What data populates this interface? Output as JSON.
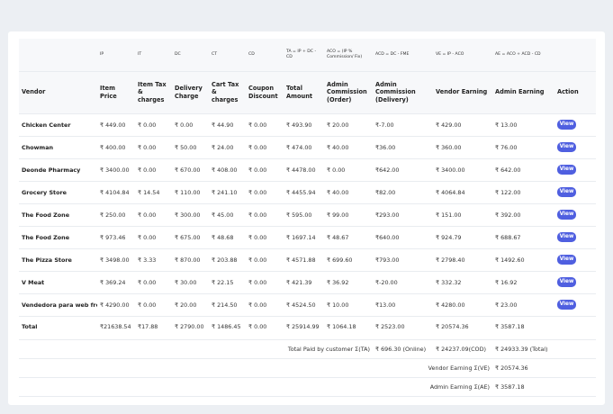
{
  "header": {
    "formulas": [
      "",
      "IP",
      "IT",
      "DC",
      "CT",
      "CD",
      "TA = IP + DC - CD",
      "ACO = (IP % Commission/ Fix)",
      "ACD = DC - FME",
      "VE = IP - ACO",
      "AE = ACO + ACD - CD",
      ""
    ],
    "labels": [
      "Vendor",
      "Item Price",
      "Item Tax & charges",
      "Delivery Charge",
      "Cart Tax & charges",
      "Coupon Discount",
      "Total Amount",
      "Admin Commission (Order)",
      "Admin Commission (Delivery)",
      "Vendor Earning",
      "Admin Earning",
      "Action"
    ]
  },
  "view_label": "View",
  "rows": [
    {
      "vendor": "Chicken Center",
      "ip": "₹ 449.00",
      "it": "₹ 0.00",
      "dc": "₹ 0.00",
      "ct": "₹ 44.90",
      "cd": "₹ 0.00",
      "ta": "₹ 493.90",
      "aco": "₹ 20.00",
      "acd": "₹-7.00",
      "ve": "₹ 429.00",
      "ae": "₹ 13.00"
    },
    {
      "vendor": "Chowman",
      "ip": "₹ 400.00",
      "it": "₹ 0.00",
      "dc": "₹ 50.00",
      "ct": "₹ 24.00",
      "cd": "₹ 0.00",
      "ta": "₹ 474.00",
      "aco": "₹ 40.00",
      "acd": "₹36.00",
      "ve": "₹ 360.00",
      "ae": "₹ 76.00"
    },
    {
      "vendor": "Deonde Pharmacy",
      "ip": "₹ 3400.00",
      "it": "₹ 0.00",
      "dc": "₹ 670.00",
      "ct": "₹ 408.00",
      "cd": "₹ 0.00",
      "ta": "₹ 4478.00",
      "aco": "₹ 0.00",
      "acd": "₹642.00",
      "ve": "₹ 3400.00",
      "ae": "₹ 642.00"
    },
    {
      "vendor": "Grocery Store",
      "ip": "₹ 4104.84",
      "it": "₹ 14.54",
      "dc": "₹ 110.00",
      "ct": "₹ 241.10",
      "cd": "₹ 0.00",
      "ta": "₹ 4455.94",
      "aco": "₹ 40.00",
      "acd": "₹82.00",
      "ve": "₹ 4064.84",
      "ae": "₹ 122.00"
    },
    {
      "vendor": "The Food Zone",
      "ip": "₹ 250.00",
      "it": "₹ 0.00",
      "dc": "₹ 300.00",
      "ct": "₹ 45.00",
      "cd": "₹ 0.00",
      "ta": "₹ 595.00",
      "aco": "₹ 99.00",
      "acd": "₹293.00",
      "ve": "₹ 151.00",
      "ae": "₹ 392.00"
    },
    {
      "vendor": "The Food Zone",
      "ip": "₹ 973.46",
      "it": "₹ 0.00",
      "dc": "₹ 675.00",
      "ct": "₹ 48.68",
      "cd": "₹ 0.00",
      "ta": "₹ 1697.14",
      "aco": "₹ 48.67",
      "acd": "₹640.00",
      "ve": "₹ 924.79",
      "ae": "₹ 688.67"
    },
    {
      "vendor": "The Pizza Store",
      "ip": "₹ 3498.00",
      "it": "₹ 3.33",
      "dc": "₹ 870.00",
      "ct": "₹ 203.88",
      "cd": "₹ 0.00",
      "ta": "₹ 4571.88",
      "aco": "₹ 699.60",
      "acd": "₹793.00",
      "ve": "₹ 2798.40",
      "ae": "₹ 1492.60"
    },
    {
      "vendor": "V Meat",
      "ip": "₹ 369.24",
      "it": "₹ 0.00",
      "dc": "₹ 30.00",
      "ct": "₹ 22.15",
      "cd": "₹ 0.00",
      "ta": "₹ 421.39",
      "aco": "₹ 36.92",
      "acd": "₹-20.00",
      "ve": "₹ 332.32",
      "ae": "₹ 16.92"
    },
    {
      "vendor": "Vendedora para web front",
      "ip": "₹ 4290.00",
      "it": "₹ 0.00",
      "dc": "₹ 20.00",
      "ct": "₹ 214.50",
      "cd": "₹ 0.00",
      "ta": "₹ 4524.50",
      "aco": "₹ 10.00",
      "acd": "₹13.00",
      "ve": "₹ 4280.00",
      "ae": "₹ 23.00"
    }
  ],
  "totals": {
    "label": "Total",
    "ip": "₹21638.54",
    "it": "₹17.88",
    "dc": "₹ 2790.00",
    "ct": "₹ 1486.45",
    "cd": "₹ 0.00",
    "ta": "₹ 25914.99",
    "aco": "₹ 1064.18",
    "acd": "₹ 2523.00",
    "ve": "₹ 20574.36",
    "ae": "₹ 3587.18"
  },
  "summary": {
    "paid_label": "Total Paid by customer Σ(TA)",
    "paid_online": "₹ 696.30 (Online)",
    "paid_cod": "₹ 24237.09(COD)",
    "paid_total": "₹ 24933.39 (Total)",
    "vendor_label": "Vendor Earning Σ(VE)",
    "vendor_value": "₹ 20574.36",
    "admin_label": "Admin Earning Σ(AE)",
    "admin_value": "₹ 3587.18"
  }
}
